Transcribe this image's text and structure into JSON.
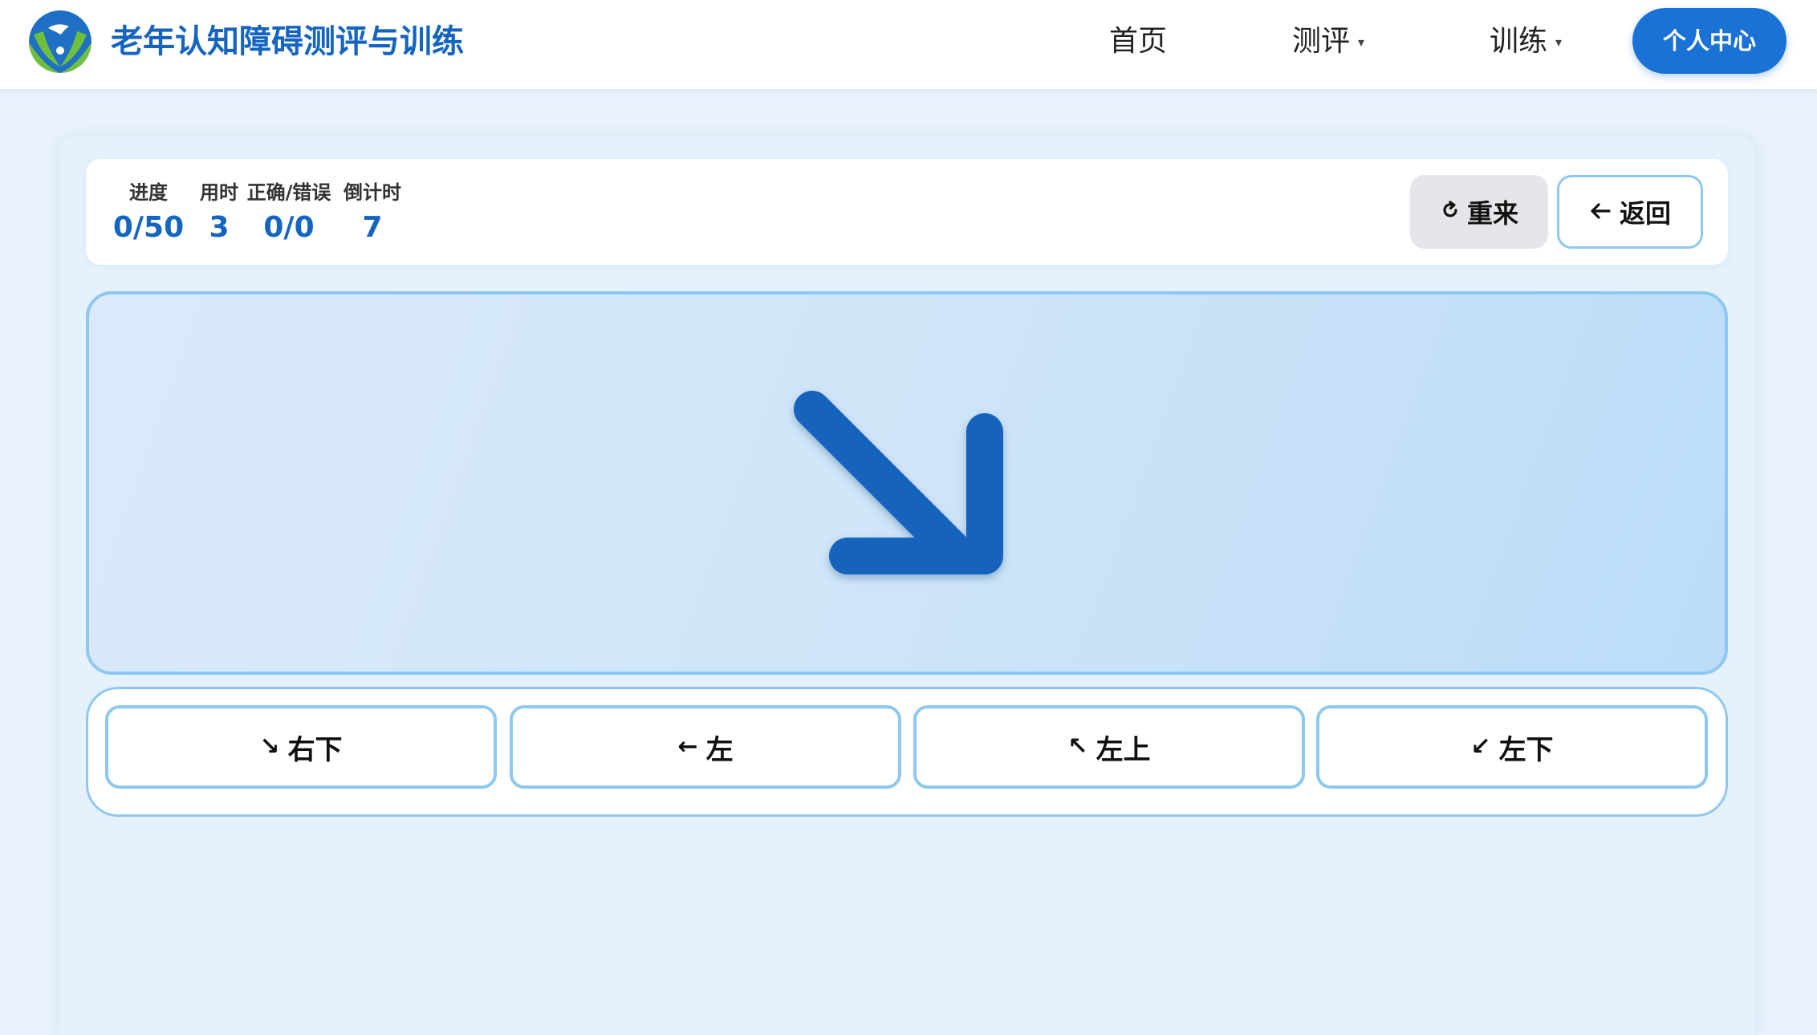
{
  "header": {
    "brand": "老年认知障碍测评与训练",
    "logo_icon": "dove-hands-logo",
    "nav": [
      {
        "label": "首页",
        "has_dropdown": false
      },
      {
        "label": "测评",
        "has_dropdown": true
      },
      {
        "label": "训练",
        "has_dropdown": true
      }
    ],
    "profile_label": "个人中心"
  },
  "stats": {
    "progress_label": "进度",
    "progress_value": "0/50",
    "time_label": "用时",
    "time_value": "3",
    "correct_label": "正确/错误",
    "correct_value": "0/0",
    "countdown_label": "倒计时",
    "countdown_value": "7"
  },
  "controls": {
    "restart_label": "重来",
    "restart_icon": "refresh-icon",
    "back_label": "返回",
    "back_icon": "arrow-left-icon"
  },
  "stimulus": {
    "direction": "右下",
    "arrow_icon": "arrow-down-right-icon"
  },
  "options": [
    {
      "glyph": "↘",
      "label": "右下",
      "icon": "arrow-down-right-icon"
    },
    {
      "glyph": "←",
      "label": "左",
      "icon": "arrow-left-icon"
    },
    {
      "glyph": "↖",
      "label": "左上",
      "icon": "arrow-up-left-icon"
    },
    {
      "glyph": "↙",
      "label": "左下",
      "icon": "arrow-down-left-icon"
    }
  ],
  "colors": {
    "primary": "#1565c0",
    "accent": "#1a72d6",
    "border": "#8ec8f0",
    "background": "#eaf3fc"
  }
}
